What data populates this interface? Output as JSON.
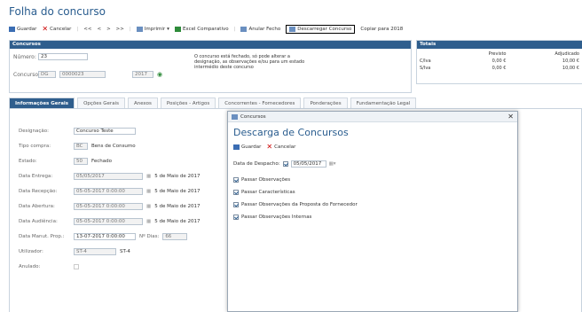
{
  "page": {
    "title": "Folha do concurso"
  },
  "toolbar": {
    "guardar": "Guardar",
    "cancelar": "Cancelar",
    "nav_first": "<<",
    "nav_prev": "<",
    "nav_next": ">",
    "nav_last": ">>",
    "imprimir": "Imprimir",
    "excel": "Excel Comparativo",
    "anular_fecho": "Anular Fecho",
    "descarregar": "Descarregar Concurso",
    "copiar": "Copiar para 2018"
  },
  "concursos": {
    "header": "Concursos",
    "numero_label": "Número:",
    "numero_value": "23",
    "concurso_label": "Concurso:",
    "concurso_code": "DG",
    "concurso_number": "0000023",
    "concurso_year": "2017",
    "note": "O concurso está fechado, só pode alterar a designação, as observações e/ou para um estado intermédio deste concurso"
  },
  "totais": {
    "header": "Totais",
    "col_previsto": "Previsto",
    "col_adjudicado": "Adjudicado",
    "rows": [
      {
        "label": "C/Iva",
        "previsto": "0,00 €",
        "adjudicado": "10,00 €"
      },
      {
        "label": "S/Iva",
        "previsto": "0,00 €",
        "adjudicado": "10,00 €"
      }
    ]
  },
  "tabs": [
    {
      "label": "Informações Gerais",
      "active": true
    },
    {
      "label": "Opções Gerais",
      "active": false
    },
    {
      "label": "Anexos",
      "active": false
    },
    {
      "label": "Posições - Artigos",
      "active": false
    },
    {
      "label": "Concorrentes - Fornecedores",
      "active": false
    },
    {
      "label": "Ponderações",
      "active": false
    },
    {
      "label": "Fundamentação Legal",
      "active": false
    }
  ],
  "form": {
    "designacao_label": "Designação:",
    "designacao_value": "Concurso Teste",
    "tipo_label": "Tipo compra:",
    "tipo_code": "BC",
    "tipo_text": "Bens de Consumo",
    "estado_label": "Estado:",
    "estado_code": "50",
    "estado_text": "Fechado",
    "data_entrega_label": "Data Entrega:",
    "data_entrega_value": "05/05/2017",
    "data_entrega_text": "5 de Maio de 2017",
    "data_recepcao_label": "Data Recepção:",
    "data_recepcao_value": "05-05-2017 0:00:00",
    "data_recepcao_text": "5 de Maio de 2017",
    "data_abertura_label": "Data Abertura:",
    "data_abertura_value": "05-05-2017 0:00:00",
    "data_abertura_text": "5 de Maio de 2017",
    "data_audiencia_label": "Data Audiência:",
    "data_audiencia_value": "05-05-2017 0:00:00",
    "data_audiencia_text": "5 de Maio de 2017",
    "data_manut_label": "Data Manut. Prop.:",
    "data_manut_value": "13-07-2017 0:00:00",
    "nr_dias_label": "Nº Dias:",
    "nr_dias_value": "66",
    "utilizador_label": "Utilizador:",
    "utilizador_code": "ST-4",
    "utilizador_text": "ST-4",
    "anulado_label": "Anulado:"
  },
  "modal": {
    "window_title": "Concursos",
    "heading": "Descarga de Concursos",
    "guardar": "Guardar",
    "cancelar": "Cancelar",
    "date_label": "Data de Despacho:",
    "date_value": "05/05/2017",
    "checks": [
      {
        "label": "Passar Observações",
        "checked": true
      },
      {
        "label": "Passar Características",
        "checked": true
      },
      {
        "label": "Passar Observações da Proposta do Fornecedor",
        "checked": true
      },
      {
        "label": "Passar Observações Internas",
        "checked": true
      }
    ]
  },
  "icons": {
    "save": "floppy-icon",
    "cancel": "x-icon",
    "print": "printer-icon",
    "excel": "excel-icon",
    "unlock": "unlock-icon",
    "download": "download-icon",
    "calendar": "calendar-icon",
    "close": "close-icon",
    "window": "window-icon"
  },
  "colors": {
    "accent": "#2f5e8d",
    "title": "#2a5d8f",
    "cancel": "#cc0000"
  }
}
